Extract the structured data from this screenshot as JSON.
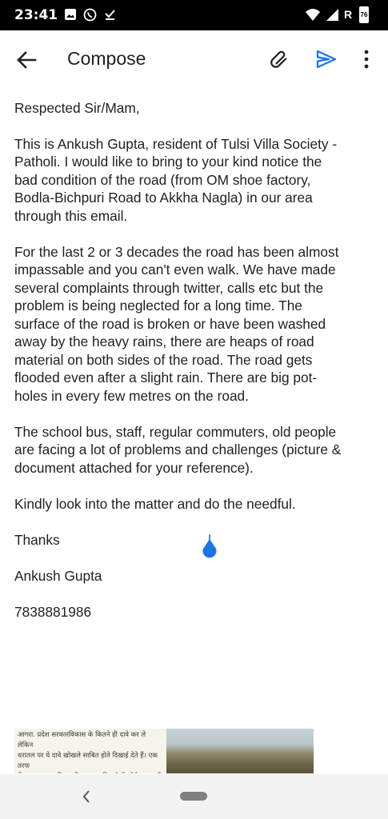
{
  "status_bar": {
    "time": "23:41",
    "icons": [
      "image-icon",
      "whatsapp-icon",
      "download-done-icon",
      "wifi-icon",
      "signal-icon",
      "roaming-icon",
      "battery-icon"
    ],
    "roaming_label": "R",
    "battery_label": "76"
  },
  "app_bar": {
    "title": "Compose",
    "icons": [
      "back-arrow-icon",
      "attach-icon",
      "send-icon",
      "more-vert-icon"
    ],
    "accent_color": "#1a73e8"
  },
  "email": {
    "salutation": "Respected Sir/Mam,",
    "para1": "This is Ankush Gupta, resident of Tulsi Villa Society -\nPatholi. I would like to bring to your kind notice the\nbad condition of the road (from OM shoe factory,\nBodla-Bichpuri Road to Akkha Nagla) in our area\nthrough this email.",
    "para2": "For the last 2 or 3 decades the road has been almost\nimpassable and you can't even walk. We have made\nseveral complaints through twitter, calls etc but the\nproblem is being neglected for a long time. The\nsurface of the road is broken or have been washed\naway by the heavy rains, there are heaps of road\nmaterial on both sides of the road. The road gets\nflooded even after a slight rain. There are big pot-\nholes in every few metres on the road.",
    "para3": "The school bus, staff, regular commuters, old people\nare facing a lot of problems and challenges (picture &\ndocument attached for your reference).",
    "para4": "Kindly look into the matter and do the needful.",
    "closing": "Thanks",
    "signature_name": "Ankush Gupta",
    "signature_phone": "7838881986"
  },
  "attachment": {
    "preview_text": "आगरा. प्रदेश सरकारविकास के कितने ही दावे कर ले लेकिन\nधरातल पर ये दावे खोखले साबित होते दिखाई देते हैं। एक तरफ\nकेंद्र सरकार पक्कीसड़कों का जाल बिछाने में कोईकसर नहीं छोड़"
  },
  "nav_bar": {
    "icons": [
      "nav-back-icon",
      "nav-home-pill"
    ]
  }
}
